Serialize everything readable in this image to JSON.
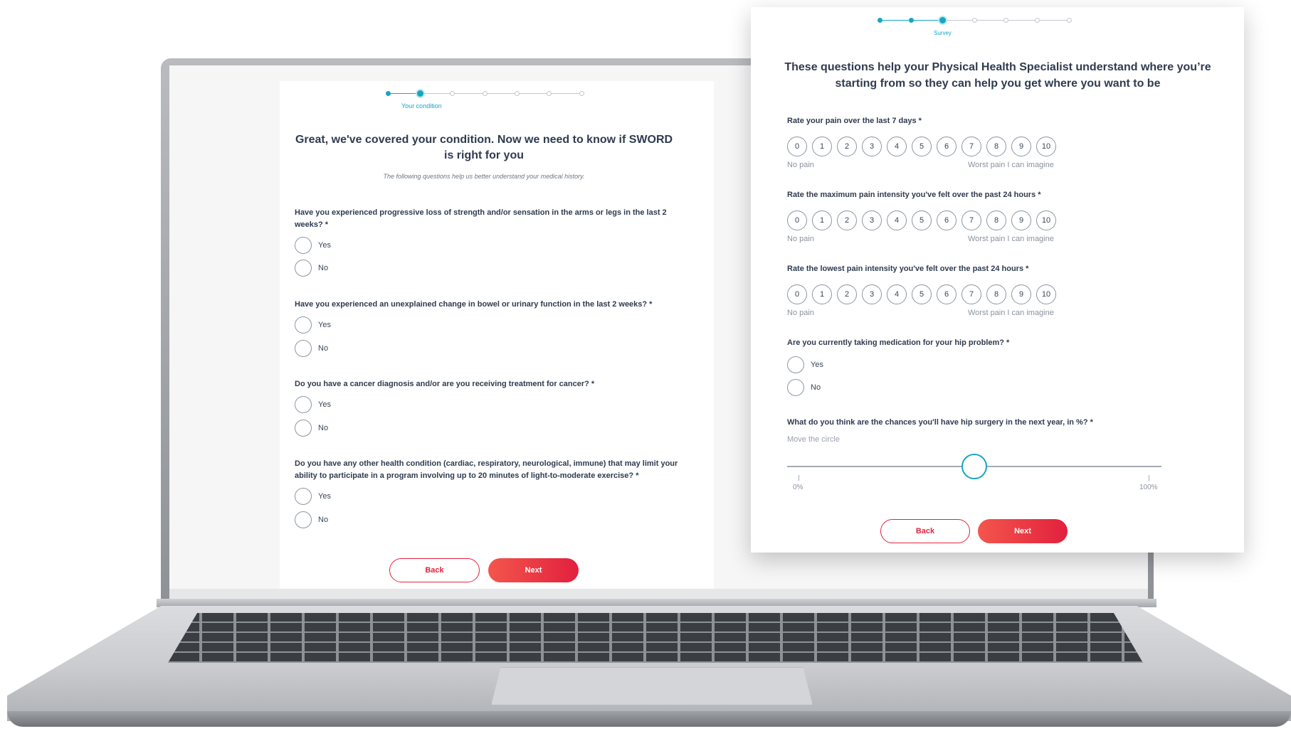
{
  "left_form": {
    "stepper": {
      "total_steps": 7,
      "current_step": 2,
      "current_label": "Your condition"
    },
    "title": "Great, we've covered your condition. Now we need to know if SWORD is right for you",
    "subtitle": "The following questions help us better understand your medical history.",
    "questions": [
      {
        "text": "Have you experienced progressive loss of strength and/or sensation in the arms or legs in the last 2 weeks? *",
        "options": [
          "Yes",
          "No"
        ]
      },
      {
        "text": "Have you experienced an unexplained change in bowel or urinary function in the last 2 weeks? *",
        "options": [
          "Yes",
          "No"
        ]
      },
      {
        "text": "Do you have a cancer diagnosis and/or are you receiving treatment for cancer? *",
        "options": [
          "Yes",
          "No"
        ]
      },
      {
        "text": "Do you have any other health condition (cardiac, respiratory, neurological, immune) that may limit your ability to participate in a program involving up to 20 minutes of light-to-moderate exercise? *",
        "options": [
          "Yes",
          "No"
        ]
      }
    ],
    "back_label": "Back",
    "next_label": "Next"
  },
  "right_form": {
    "stepper": {
      "total_steps": 7,
      "current_step": 3,
      "current_label": "Survey"
    },
    "title": "These questions help your Physical Health Specialist understand where you’re starting from so they can help you get where you want to be",
    "ratings": [
      {
        "question": "Rate your pain over the last 7 days *",
        "values": [
          "0",
          "1",
          "2",
          "3",
          "4",
          "5",
          "6",
          "7",
          "8",
          "9",
          "10"
        ],
        "min_label": "No pain",
        "max_label": "Worst pain I can imagine"
      },
      {
        "question": "Rate the maximum pain intensity you've felt over the past 24 hours *",
        "values": [
          "0",
          "1",
          "2",
          "3",
          "4",
          "5",
          "6",
          "7",
          "8",
          "9",
          "10"
        ],
        "min_label": "No pain",
        "max_label": "Worst pain I can imagine"
      },
      {
        "question": "Rate the lowest pain intensity you've felt over the past 24 hours *",
        "values": [
          "0",
          "1",
          "2",
          "3",
          "4",
          "5",
          "6",
          "7",
          "8",
          "9",
          "10"
        ],
        "min_label": "No pain",
        "max_label": "Worst pain I can imagine"
      }
    ],
    "medication": {
      "question": "Are you currently taking medication for your hip problem? *",
      "options": [
        "Yes",
        "No"
      ]
    },
    "surgery": {
      "question": "What do you think are the chances you'll have hip surgery in the next year, in %? *",
      "hint": "Move the circle",
      "min_label": "0%",
      "max_label": "100%",
      "value_percent": 50
    },
    "back_label": "Back",
    "next_label": "Next"
  },
  "colors": {
    "accent": "#16a6c4",
    "primary": "#e2243d",
    "text": "#2f3b50"
  }
}
